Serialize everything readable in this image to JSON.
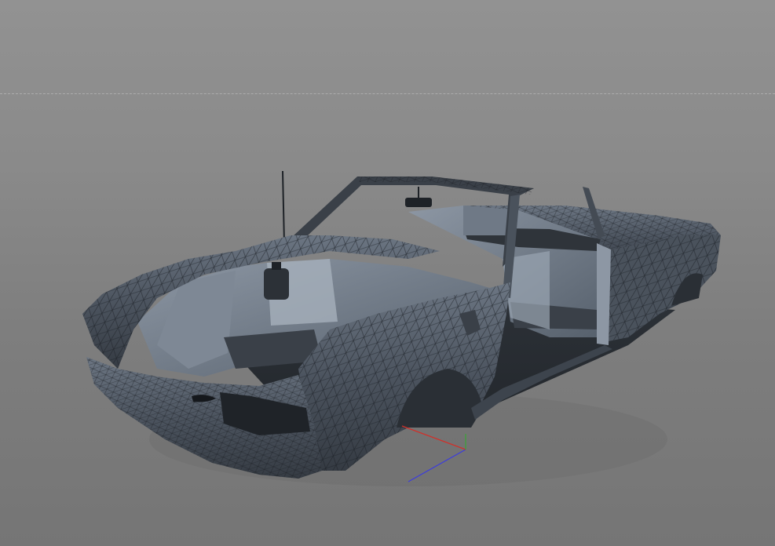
{
  "viewport": {
    "background_color": "#828282",
    "horizon_line_color": "#b4b4b4"
  },
  "model": {
    "shading": "shaded-wireframe",
    "surface_color": "#505761",
    "wire_color": "#1e2227",
    "highlight_color": "#8a95a3"
  },
  "axis_gizmo": {
    "x_color": "#d0302a",
    "y_color": "#3aa536",
    "z_color": "#3a3ae0"
  }
}
